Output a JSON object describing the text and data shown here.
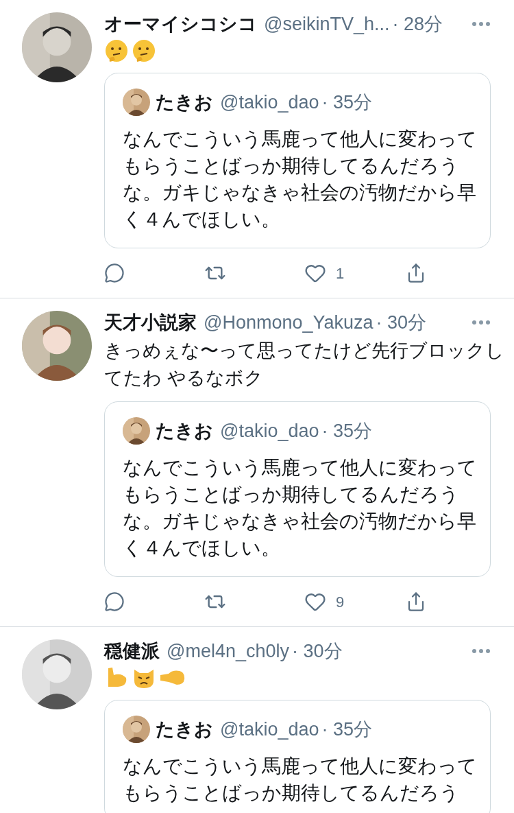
{
  "tweets": [
    {
      "name": "オーマイシコシコ",
      "handle": "@seikinTV_h...",
      "time": "· 28分",
      "avatar": {
        "kind": "wolf"
      },
      "emojis": [
        {
          "kind": "thinking"
        },
        {
          "kind": "thinking"
        }
      ],
      "quote": {
        "name": "たきお",
        "handle": "@takio_dao",
        "time": "· 35分",
        "text": "なんでこういう馬鹿って他人に変わってもらうことばっか期待してるんだろうな。ガキじゃなきゃ社会の汚物だから早く４んでほしい。"
      },
      "like_count": "1"
    },
    {
      "name": "天才小説家",
      "handle": "@Honmono_Yakuza",
      "time": "· 30分",
      "avatar": {
        "kind": "anime"
      },
      "text": "きっめぇな〜って思ってたけど先行ブロックしてたわ やるなボク",
      "quote": {
        "name": "たきお",
        "handle": "@takio_dao",
        "time": "· 35分",
        "text": "なんでこういう馬鹿って他人に変わってもらうことばっか期待してるんだろうな。ガキじゃなきゃ社会の汚物だから早く４んでほしい。"
      },
      "like_count": "9"
    },
    {
      "name": "穏健派",
      "handle": "@mel4n_ch0ly",
      "time": "· 30分",
      "avatar": {
        "kind": "sketch"
      },
      "emojis": [
        {
          "kind": "biceps"
        },
        {
          "kind": "cat"
        },
        {
          "kind": "fist"
        }
      ],
      "quote": {
        "name": "たきお",
        "handle": "@takio_dao",
        "time": "· 35分",
        "text": "なんでこういう馬鹿って他人に変わってもらうことばっか期待してるんだろう"
      }
    }
  ]
}
